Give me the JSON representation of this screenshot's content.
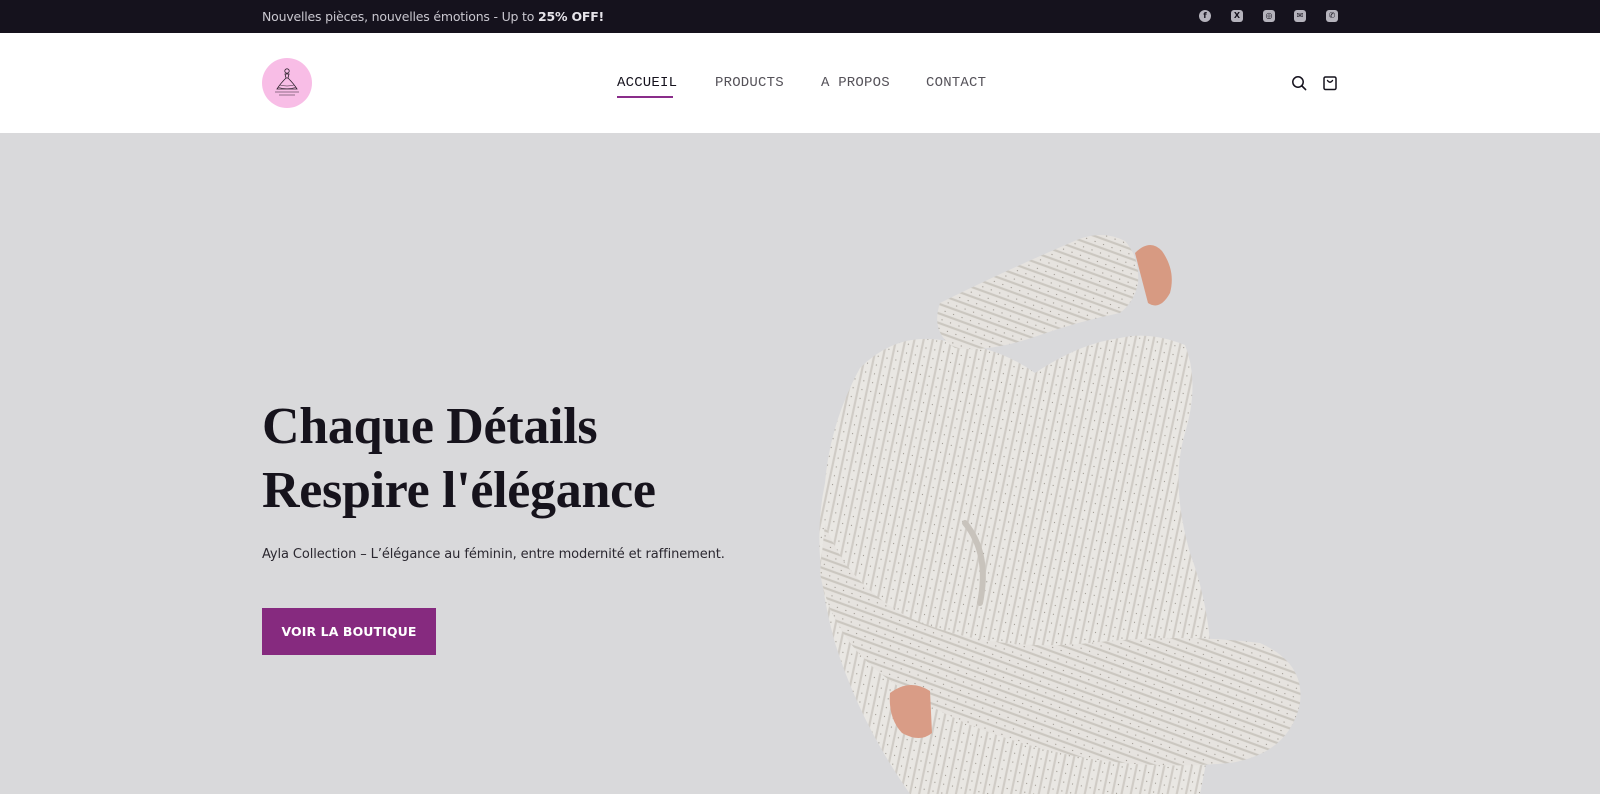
{
  "announcement": {
    "text": "Nouvelles pièces, nouvelles émotions - Up to ",
    "highlight": "25% OFF!"
  },
  "social": [
    {
      "icon": "facebook-icon",
      "glyph": "f"
    },
    {
      "icon": "x-icon",
      "glyph": "X"
    },
    {
      "icon": "instagram-icon",
      "glyph": "◎"
    },
    {
      "icon": "mail-icon",
      "glyph": "✉"
    },
    {
      "icon": "phone-icon",
      "glyph": "✆"
    }
  ],
  "nav": {
    "items": [
      "ACCUEIL",
      "PRODUCTS",
      "A PROPOS",
      "CONTACT"
    ],
    "active": "ACCUEIL"
  },
  "header_icons": [
    "search-icon",
    "shopping-bag-icon"
  ],
  "hero": {
    "headline_line1": "Chaque Détails",
    "headline_line2": "Respire l'élégance",
    "subtitle": "Ayla Collection – L’élégance au féminin, entre modernité et raffinement.",
    "cta": "VOIR LA BOUTIQUE"
  },
  "colors": {
    "topbar": "#15121d",
    "accent": "#862a7f",
    "hero_bg": "#d9d9db",
    "logo_bg": "#f8bde6"
  }
}
